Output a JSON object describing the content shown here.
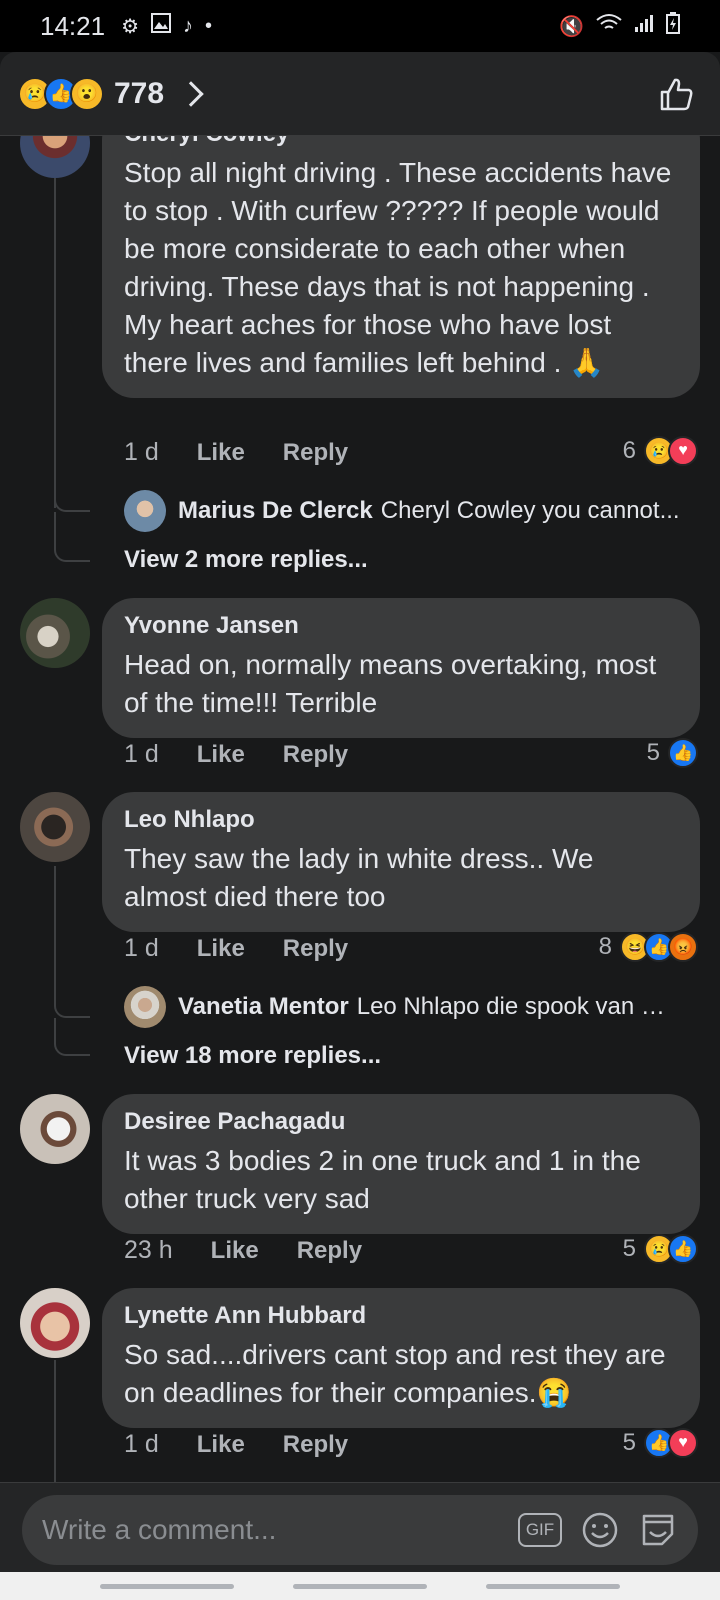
{
  "status_bar": {
    "time": "14:21"
  },
  "header": {
    "reaction_count": "778",
    "reactions": [
      "sad",
      "like",
      "wow"
    ]
  },
  "comments": [
    {
      "author": "Cheryl Cowley",
      "text": "Stop all night driving . These accidents have to stop . With curfew ????? If people would be more considerate to each other when driving. These days that is not happening . My heart aches for those who have lost there lives and families left behind . 🙏",
      "time": "1 d",
      "like": "Like",
      "reply": "Reply",
      "reaction_count": "6",
      "reactions": [
        "sad",
        "love"
      ],
      "reply_preview": {
        "author": "Marius De Clerck",
        "text": "Cheryl Cowley you cannot..."
      },
      "more_replies": "View 2 more replies..."
    },
    {
      "author": "Yvonne Jansen",
      "text": "Head on, normally means overtaking, most of the time!!!  Terrible",
      "time": "1 d",
      "like": "Like",
      "reply": "Reply",
      "reaction_count": "5",
      "reactions": [
        "like"
      ]
    },
    {
      "author": "Leo Nhlapo",
      "text": "They saw the lady in white dress.. We almost died there too",
      "time": "1 d",
      "like": "Like",
      "reply": "Reply",
      "reaction_count": "8",
      "reactions": [
        "haha",
        "like",
        "angry"
      ],
      "reply_preview": {
        "author": "Vanetia Mentor",
        "text": "Leo Nhlapo die spook van U..."
      },
      "more_replies": "View 18 more replies..."
    },
    {
      "author": "Desiree Pachagadu",
      "text": "It was 3 bodies 2 in one truck and 1 in the other truck very sad",
      "time": "23 h",
      "like": "Like",
      "reply": "Reply",
      "reaction_count": "5",
      "reactions": [
        "sad",
        "like"
      ]
    },
    {
      "author": "Lynette Ann Hubbard",
      "text": "So sad....drivers cant stop and rest they are on deadlines for their companies.😭",
      "time": "1 d",
      "like": "Like",
      "reply": "Reply",
      "reaction_count": "5",
      "reactions": [
        "like",
        "love"
      ]
    }
  ],
  "composer": {
    "placeholder": "Write a comment...",
    "gif_label": "GIF"
  },
  "colors": {
    "background": "#18191a",
    "bubble": "#3a3b3c",
    "like_blue": "#1877f2",
    "love_red": "#f33e58",
    "sad_yellow": "#f7b928"
  }
}
